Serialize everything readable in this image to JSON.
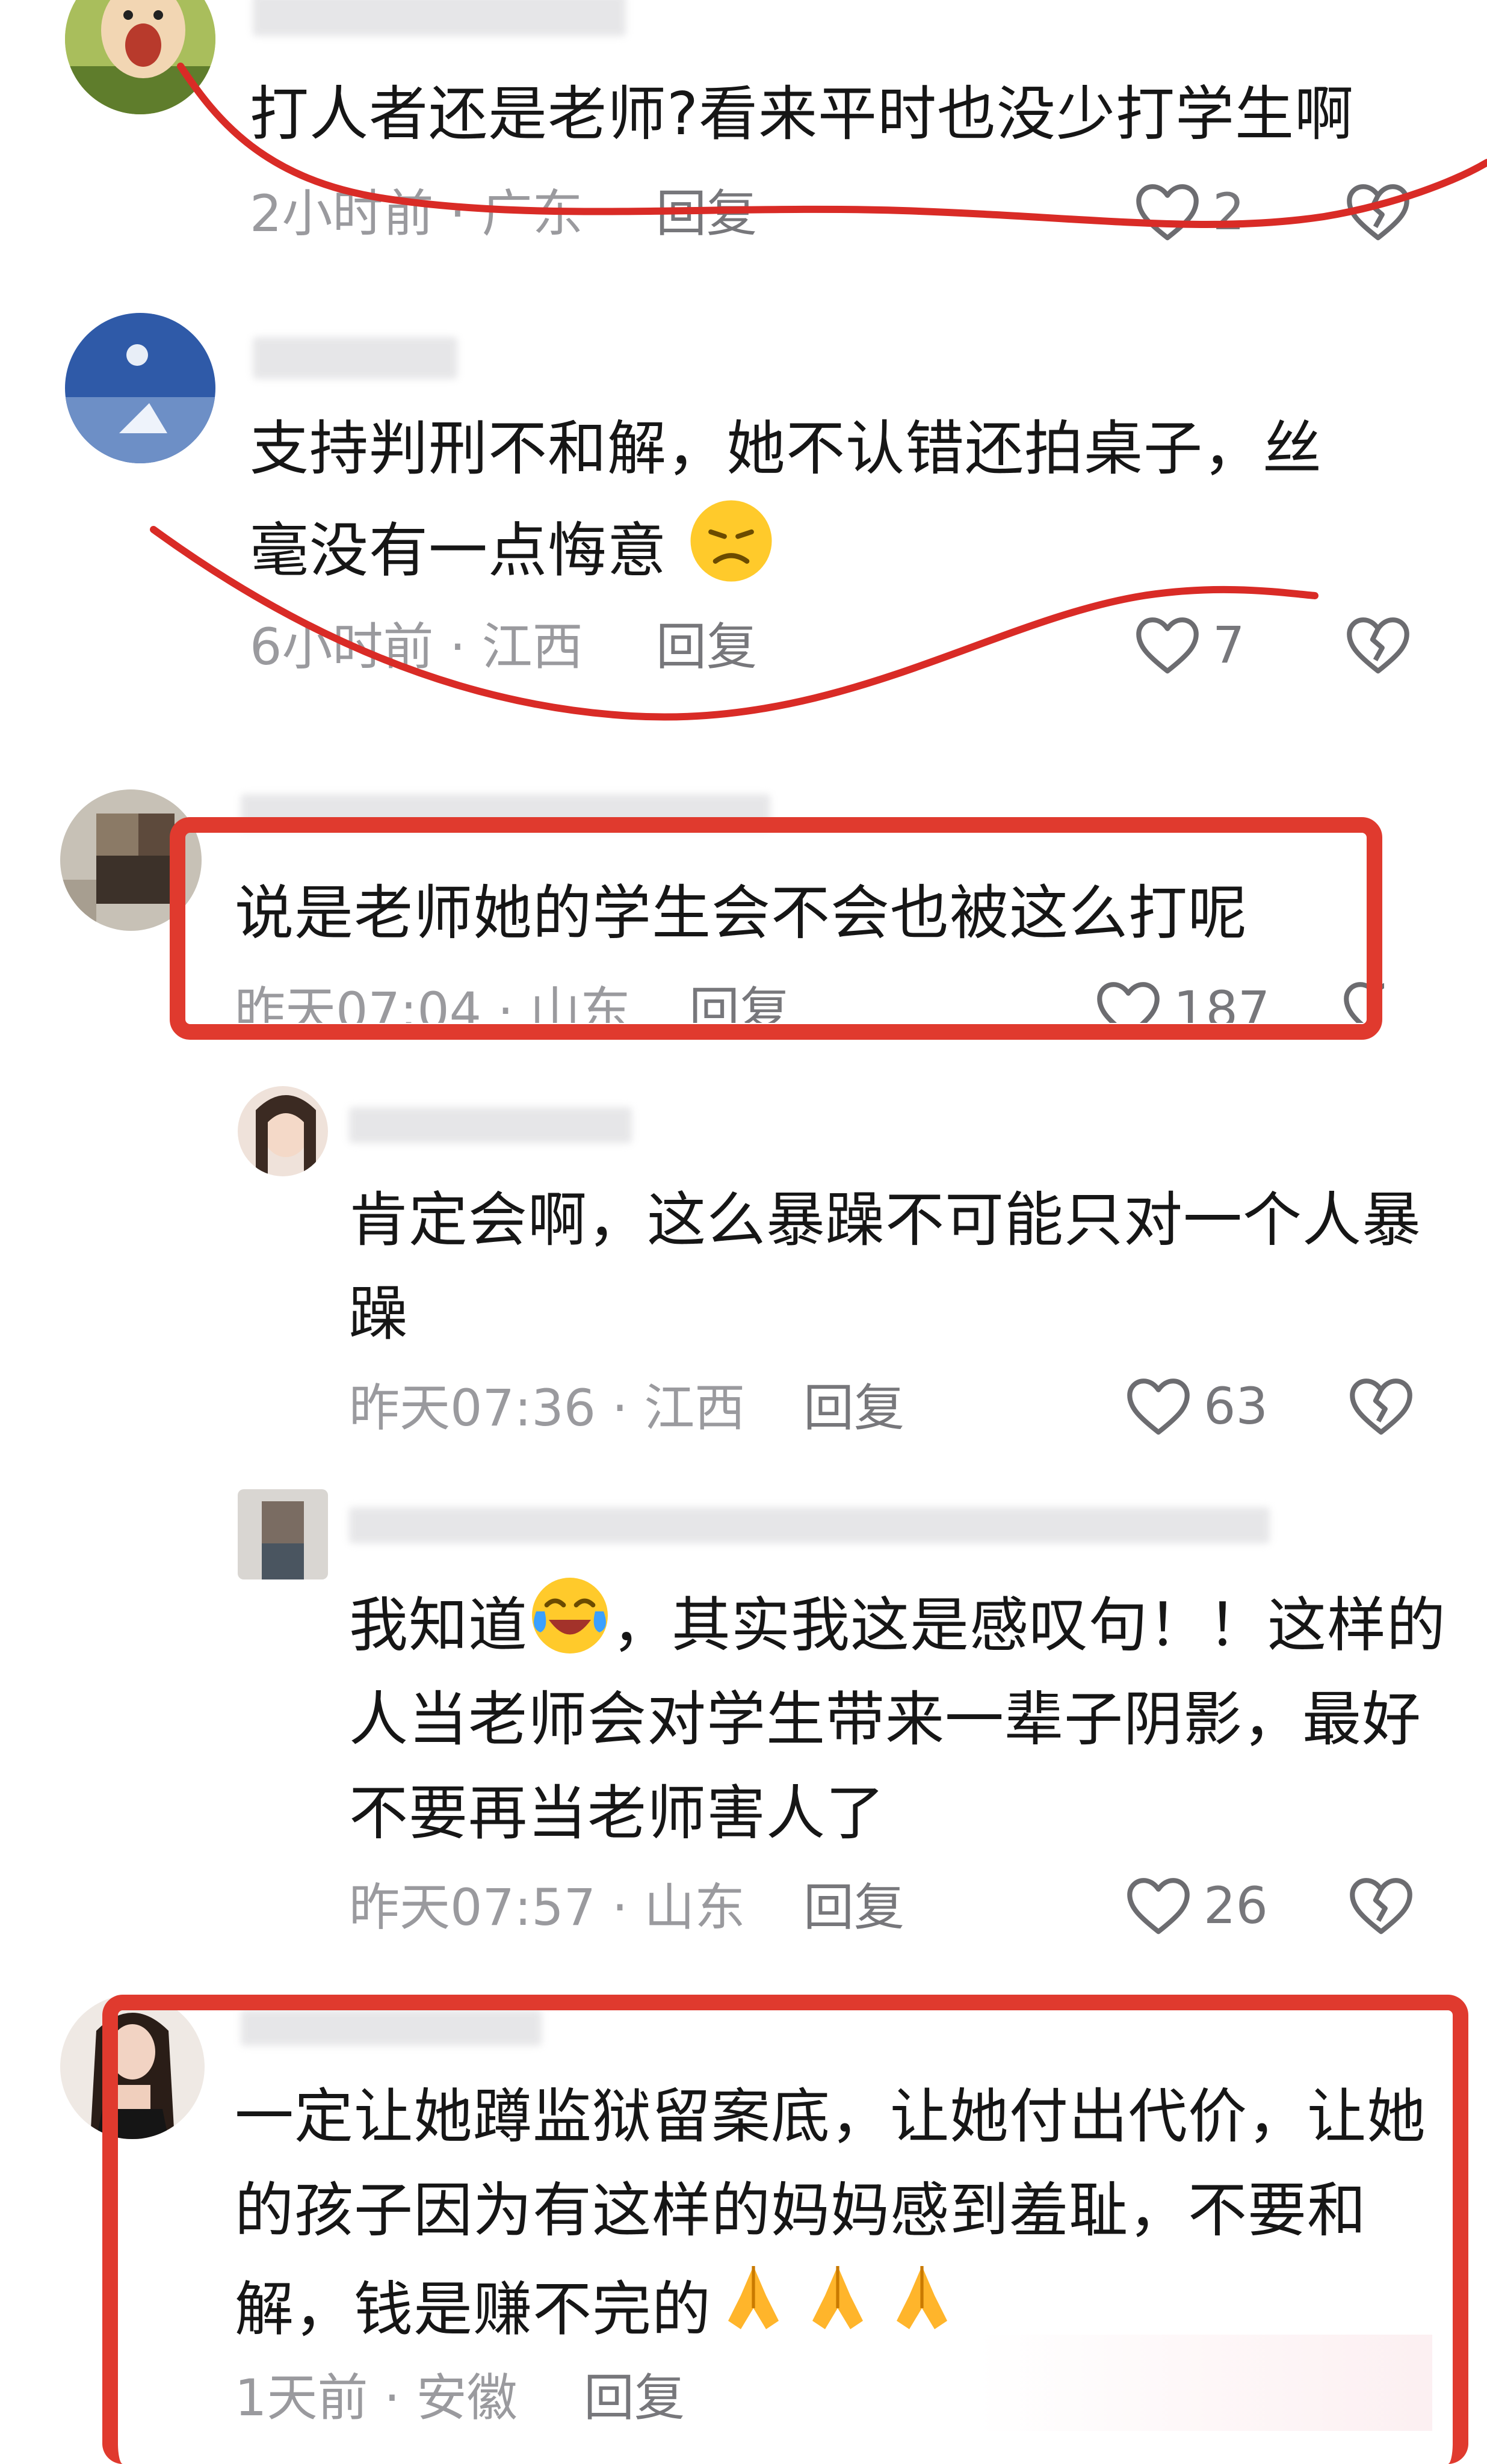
{
  "comments": [
    {
      "text": "打人者还是老师?看来平时也没少打学生啊",
      "time": "2小时前",
      "location": "广东",
      "reply": "回复",
      "likes": "2"
    },
    {
      "text_line1": "支持判刑不和解，她不认错还拍桌子，丝",
      "text_line2": "毫没有一点悔意",
      "time": "6小时前",
      "location": "江西",
      "reply": "回复",
      "likes": "7"
    },
    {
      "text": "说是老师她的学生会不会也被这么打呢",
      "time": "昨天07:04",
      "location": "山东",
      "reply": "回复",
      "likes": "187"
    },
    {
      "text_line1": "肯定会啊，这么暴躁不可能只对一个人暴",
      "text_line2": "躁",
      "time": "昨天07:36",
      "location": "江西",
      "reply": "回复",
      "likes": "63"
    },
    {
      "text_line1_a": "我知道",
      "text_line1_b": "，其实我这是感叹句！！这样的",
      "text_line2": "人当老师会对学生带来一辈子阴影，最好",
      "text_line3": "不要再当老师害人了",
      "time": "昨天07:57",
      "location": "山东",
      "reply": "回复",
      "likes": "26"
    },
    {
      "text_line1": "一定让她蹲监狱留案底，让她付出代价，让她",
      "text_line2": "的孩子因为有这样的妈妈感到羞耻，不要和",
      "text_line3": "解，钱是赚不完的",
      "time": "1天前",
      "location": "安徽",
      "reply": "回复"
    }
  ],
  "separator": " · ",
  "colors": {
    "annotation_red": "#e03a2e",
    "meta_gray": "#9a9a9e"
  },
  "icons": [
    "heart-outline-icon",
    "broken-heart-icon",
    "frowning-face-emoji",
    "laughing-tears-emoji",
    "praying-hands-emoji"
  ]
}
